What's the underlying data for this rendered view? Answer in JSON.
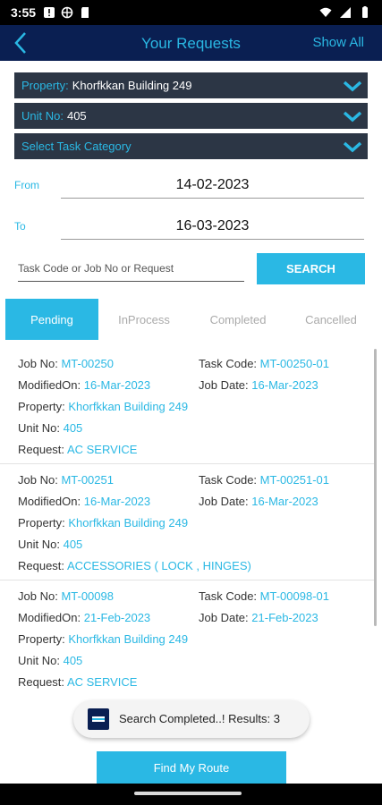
{
  "status_bar": {
    "time": "3:55"
  },
  "header": {
    "title": "Your Requests",
    "show_all": "Show All"
  },
  "filters": {
    "property": {
      "label": "Property:",
      "value": "Khorfkkan  Building 249"
    },
    "unit": {
      "label": "Unit No:",
      "value": "405"
    },
    "task_category": {
      "label": "Select Task Category"
    }
  },
  "dates": {
    "from_label": "From",
    "from_value": "14-02-2023",
    "to_label": "To",
    "to_value": "16-03-2023"
  },
  "search": {
    "placeholder": "Task Code or Job No or Request",
    "button": "SEARCH"
  },
  "tabs": [
    {
      "label": "Pending"
    },
    {
      "label": "InProcess"
    },
    {
      "label": "Completed"
    },
    {
      "label": "Cancelled"
    }
  ],
  "field_labels": {
    "job_no": "Job No:",
    "task_code": "Task Code:",
    "modified_on": "ModifiedOn:",
    "job_date": "Job Date:",
    "property": "Property:",
    "unit_no": "Unit No:",
    "request": "Request:"
  },
  "jobs": [
    {
      "job_no": "MT-00250",
      "task_code": "MT-00250-01",
      "modified_on": "16-Mar-2023",
      "job_date": "16-Mar-2023",
      "property": "Khorfkkan  Building 249",
      "unit_no": "405",
      "request": "AC SERVICE"
    },
    {
      "job_no": "MT-00251",
      "task_code": "MT-00251-01",
      "modified_on": "16-Mar-2023",
      "job_date": "16-Mar-2023",
      "property": "Khorfkkan  Building 249",
      "unit_no": "405",
      "request": "ACCESSORIES ( LOCK , HINGES)"
    },
    {
      "job_no": "MT-00098",
      "task_code": "MT-00098-01",
      "modified_on": "21-Feb-2023",
      "job_date": "21-Feb-2023",
      "property": "Khorfkkan  Building 249",
      "unit_no": "405",
      "request": "AC SERVICE"
    }
  ],
  "toast": {
    "text": "Search Completed..! Results: 3"
  },
  "route_button": {
    "label": "Find My Route"
  },
  "colors": {
    "accent": "#2ab8e4",
    "header_bg": "#0a1f52",
    "dropdown_bg": "#2c3645"
  }
}
